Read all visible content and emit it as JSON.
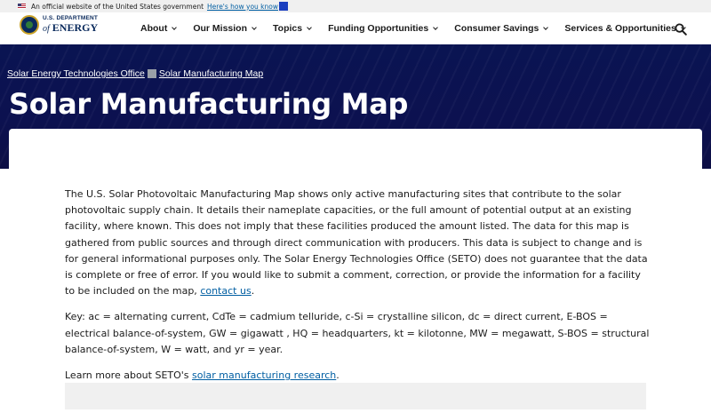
{
  "gov_banner": {
    "text": "An official website of the United States government",
    "link": "Here's how you know"
  },
  "logo": {
    "line1": "U.S. DEPARTMENT",
    "line2_of": "of",
    "line2_energy": "ENERGY"
  },
  "nav": {
    "items": [
      {
        "label": "About"
      },
      {
        "label": "Our Mission"
      },
      {
        "label": "Topics"
      },
      {
        "label": "Funding Opportunities"
      },
      {
        "label": "Consumer Savings"
      },
      {
        "label": "Services & Opportunities"
      }
    ],
    "search_icon": "search-icon"
  },
  "breadcrumb": {
    "items": [
      "Solar Energy Technologies Office",
      "Solar Manufacturing Map"
    ]
  },
  "page": {
    "title": "Solar Manufacturing Map"
  },
  "content": {
    "p1_text": "The U.S. Solar Photovoltaic Manufacturing Map shows only active manufacturing sites that contribute to the solar photovoltaic supply chain. It details their nameplate capacities, or the full amount of potential output at an existing facility, where known. This does not imply that these facilities produced the amount listed. The data for this map is gathered from public sources and through direct communication with producers. This data is subject to change and is for general informational purposes only. The Solar Energy Technologies Office (SETO) does not guarantee that the data is complete or free of error. If you would like to submit a comment, correction, or provide the information for a facility to be included on the map, ",
    "p1_link": "contact us",
    "p1_end": ".",
    "p2_text": "Key: ac = alternating current, CdTe = cadmium telluride, c-Si = crystalline silicon, dc = direct current, E-BOS = electrical balance-of-system, GW = gigawatt , HQ = headquarters, kt = kilotonne, MW = megawatt, S-BOS = structural balance-of-system, W = watt, and yr = year.",
    "p3_text": "Learn more about SETO's ",
    "p3_link": "solar manufacturing research",
    "p3_end": "."
  },
  "colors": {
    "hero_bg": "#0c1246",
    "link": "#005ea2",
    "text": "#1b1b1b"
  }
}
